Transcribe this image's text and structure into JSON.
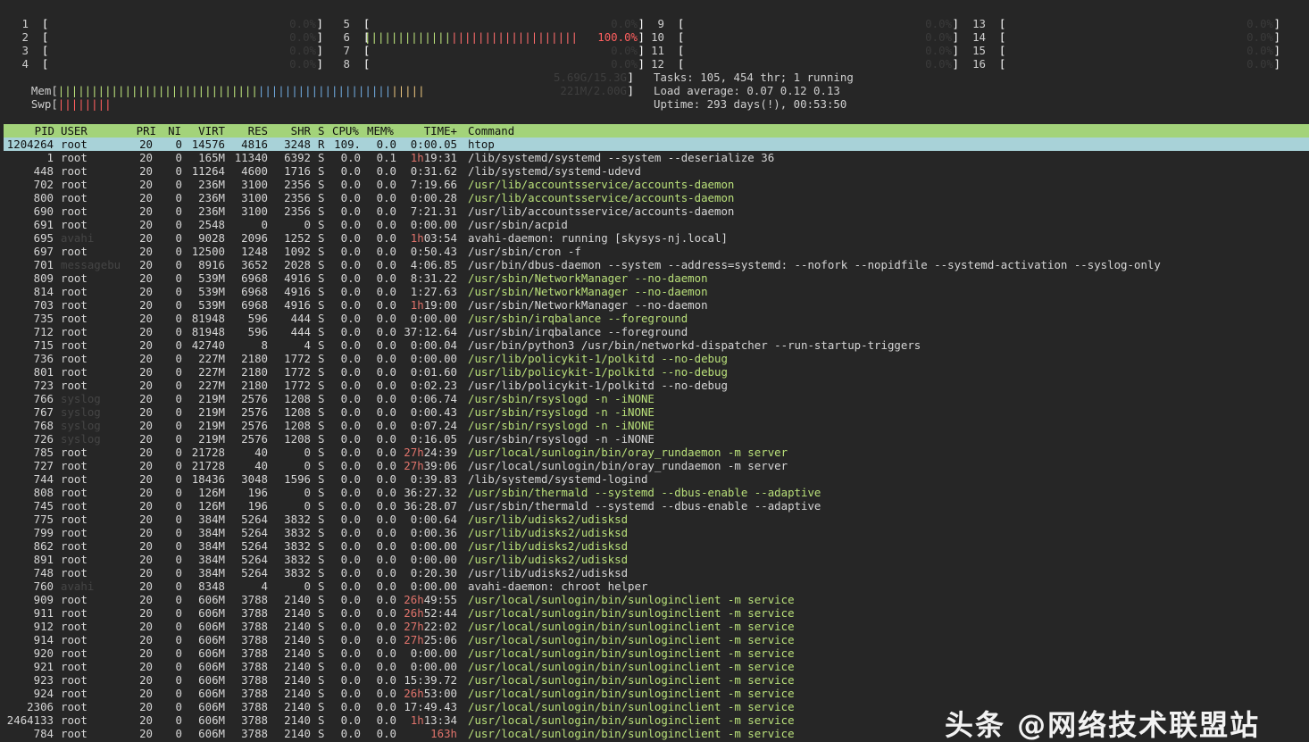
{
  "cpus": [
    {
      "n": "1",
      "pct": "0.0%",
      "fill": 0
    },
    {
      "n": "2",
      "pct": "0.0%",
      "fill": 0
    },
    {
      "n": "3",
      "pct": "0.0%",
      "fill": 0
    },
    {
      "n": "4",
      "pct": "0.0%",
      "fill": 0
    },
    {
      "n": "5",
      "pct": "0.0%",
      "fill": 0
    },
    {
      "n": "6",
      "pct": "100.0%",
      "fill": 1
    },
    {
      "n": "7",
      "pct": "0.0%",
      "fill": 0
    },
    {
      "n": "8",
      "pct": "0.0%",
      "fill": 0
    },
    {
      "n": "9",
      "pct": "0.0%",
      "fill": 0
    },
    {
      "n": "10",
      "pct": "0.0%",
      "fill": 0
    },
    {
      "n": "11",
      "pct": "0.0%",
      "fill": 0
    },
    {
      "n": "12",
      "pct": "0.0%",
      "fill": 0
    },
    {
      "n": "13",
      "pct": "0.0%",
      "fill": 0
    },
    {
      "n": "14",
      "pct": "0.0%",
      "fill": 0
    },
    {
      "n": "15",
      "pct": "0.0%",
      "fill": 0
    },
    {
      "n": "16",
      "pct": "0.0%",
      "fill": 0
    }
  ],
  "mem": {
    "label": "Mem",
    "value": "5.69G/15.3G",
    "fill": 0.372
  },
  "swp": {
    "label": "Swp",
    "value": "221M/2.00G",
    "fill": 0.108
  },
  "tasks": "Tasks: 105, 454 thr; 1 running",
  "load": "Load average: 0.07 0.12 0.13",
  "uptime": "Uptime: 293 days(!), 00:53:50",
  "columns": {
    "pid": "PID",
    "user": "USER",
    "pri": "PRI",
    "ni": "NI",
    "virt": "VIRT",
    "res": "RES",
    "shr": "SHR",
    "s": "S",
    "cpu": "CPU%",
    "mem": "MEM%",
    "time": "TIME+",
    "cmd": "Command"
  },
  "processes": [
    {
      "pid": "1204264",
      "user": "root",
      "pri": "20",
      "ni": "0",
      "virt": "14576",
      "res": "4816",
      "shr": "3248",
      "s": "R",
      "cpu": "109.",
      "mem": "0.0",
      "th": "",
      "time": "0:00.05",
      "cmd": "htop",
      "green": false,
      "dim": false
    },
    {
      "pid": "1",
      "user": "root",
      "pri": "20",
      "ni": "0",
      "virt": "165M",
      "res": "11340",
      "shr": "6392",
      "s": "S",
      "cpu": "0.0",
      "mem": "0.1",
      "th": "1h",
      "time": "19:31",
      "cmd": "/lib/systemd/systemd --system --deserialize 36",
      "green": false,
      "dim": false
    },
    {
      "pid": "448",
      "user": "root",
      "pri": "20",
      "ni": "0",
      "virt": "11264",
      "res": "4600",
      "shr": "1716",
      "s": "S",
      "cpu": "0.0",
      "mem": "0.0",
      "th": "",
      "time": "0:31.62",
      "cmd": "/lib/systemd/systemd-udevd",
      "green": false,
      "dim": false
    },
    {
      "pid": "702",
      "user": "root",
      "pri": "20",
      "ni": "0",
      "virt": "236M",
      "res": "3100",
      "shr": "2356",
      "s": "S",
      "cpu": "0.0",
      "mem": "0.0",
      "th": "",
      "time": "7:19.66",
      "cmd": "/usr/lib/accountsservice/accounts-daemon",
      "green": true,
      "dim": false
    },
    {
      "pid": "800",
      "user": "root",
      "pri": "20",
      "ni": "0",
      "virt": "236M",
      "res": "3100",
      "shr": "2356",
      "s": "S",
      "cpu": "0.0",
      "mem": "0.0",
      "th": "",
      "time": "0:00.28",
      "cmd": "/usr/lib/accountsservice/accounts-daemon",
      "green": true,
      "dim": false
    },
    {
      "pid": "690",
      "user": "root",
      "pri": "20",
      "ni": "0",
      "virt": "236M",
      "res": "3100",
      "shr": "2356",
      "s": "S",
      "cpu": "0.0",
      "mem": "0.0",
      "th": "",
      "time": "7:21.31",
      "cmd": "/usr/lib/accountsservice/accounts-daemon",
      "green": false,
      "dim": false
    },
    {
      "pid": "691",
      "user": "root",
      "pri": "20",
      "ni": "0",
      "virt": "2548",
      "res": "0",
      "shr": "0",
      "s": "S",
      "cpu": "0.0",
      "mem": "0.0",
      "th": "",
      "time": "0:00.00",
      "cmd": "/usr/sbin/acpid",
      "green": false,
      "dim": false
    },
    {
      "pid": "695",
      "user": "avahi",
      "pri": "20",
      "ni": "0",
      "virt": "9028",
      "res": "2096",
      "shr": "1252",
      "s": "S",
      "cpu": "0.0",
      "mem": "0.0",
      "th": "1h",
      "time": "03:54",
      "cmd": "avahi-daemon: running [skysys-nj.local]",
      "green": false,
      "dim": true
    },
    {
      "pid": "697",
      "user": "root",
      "pri": "20",
      "ni": "0",
      "virt": "12500",
      "res": "1248",
      "shr": "1092",
      "s": "S",
      "cpu": "0.0",
      "mem": "0.0",
      "th": "",
      "time": "0:50.43",
      "cmd": "/usr/sbin/cron -f",
      "green": false,
      "dim": false
    },
    {
      "pid": "701",
      "user": "messagebu",
      "pri": "20",
      "ni": "0",
      "virt": "8916",
      "res": "3652",
      "shr": "2028",
      "s": "S",
      "cpu": "0.0",
      "mem": "0.0",
      "th": "",
      "time": "4:06.85",
      "cmd": "/usr/bin/dbus-daemon --system --address=systemd: --nofork --nopidfile --systemd-activation --syslog-only",
      "green": false,
      "dim": true
    },
    {
      "pid": "809",
      "user": "root",
      "pri": "20",
      "ni": "0",
      "virt": "539M",
      "res": "6968",
      "shr": "4916",
      "s": "S",
      "cpu": "0.0",
      "mem": "0.0",
      "th": "",
      "time": "8:31.22",
      "cmd": "/usr/sbin/NetworkManager --no-daemon",
      "green": true,
      "dim": false
    },
    {
      "pid": "814",
      "user": "root",
      "pri": "20",
      "ni": "0",
      "virt": "539M",
      "res": "6968",
      "shr": "4916",
      "s": "S",
      "cpu": "0.0",
      "mem": "0.0",
      "th": "",
      "time": "1:27.63",
      "cmd": "/usr/sbin/NetworkManager --no-daemon",
      "green": true,
      "dim": false
    },
    {
      "pid": "703",
      "user": "root",
      "pri": "20",
      "ni": "0",
      "virt": "539M",
      "res": "6968",
      "shr": "4916",
      "s": "S",
      "cpu": "0.0",
      "mem": "0.0",
      "th": "1h",
      "time": "19:00",
      "cmd": "/usr/sbin/NetworkManager --no-daemon",
      "green": false,
      "dim": false
    },
    {
      "pid": "735",
      "user": "root",
      "pri": "20",
      "ni": "0",
      "virt": "81948",
      "res": "596",
      "shr": "444",
      "s": "S",
      "cpu": "0.0",
      "mem": "0.0",
      "th": "",
      "time": "0:00.00",
      "cmd": "/usr/sbin/irqbalance --foreground",
      "green": true,
      "dim": false
    },
    {
      "pid": "712",
      "user": "root",
      "pri": "20",
      "ni": "0",
      "virt": "81948",
      "res": "596",
      "shr": "444",
      "s": "S",
      "cpu": "0.0",
      "mem": "0.0",
      "th": "",
      "time": "37:12.64",
      "cmd": "/usr/sbin/irqbalance --foreground",
      "green": false,
      "dim": false
    },
    {
      "pid": "715",
      "user": "root",
      "pri": "20",
      "ni": "0",
      "virt": "42740",
      "res": "8",
      "shr": "4",
      "s": "S",
      "cpu": "0.0",
      "mem": "0.0",
      "th": "",
      "time": "0:00.04",
      "cmd": "/usr/bin/python3 /usr/bin/networkd-dispatcher --run-startup-triggers",
      "green": false,
      "dim": false
    },
    {
      "pid": "736",
      "user": "root",
      "pri": "20",
      "ni": "0",
      "virt": "227M",
      "res": "2180",
      "shr": "1772",
      "s": "S",
      "cpu": "0.0",
      "mem": "0.0",
      "th": "",
      "time": "0:00.00",
      "cmd": "/usr/lib/policykit-1/polkitd --no-debug",
      "green": true,
      "dim": false
    },
    {
      "pid": "801",
      "user": "root",
      "pri": "20",
      "ni": "0",
      "virt": "227M",
      "res": "2180",
      "shr": "1772",
      "s": "S",
      "cpu": "0.0",
      "mem": "0.0",
      "th": "",
      "time": "0:01.60",
      "cmd": "/usr/lib/policykit-1/polkitd --no-debug",
      "green": true,
      "dim": false
    },
    {
      "pid": "723",
      "user": "root",
      "pri": "20",
      "ni": "0",
      "virt": "227M",
      "res": "2180",
      "shr": "1772",
      "s": "S",
      "cpu": "0.0",
      "mem": "0.0",
      "th": "",
      "time": "0:02.23",
      "cmd": "/usr/lib/policykit-1/polkitd --no-debug",
      "green": false,
      "dim": false
    },
    {
      "pid": "766",
      "user": "syslog",
      "pri": "20",
      "ni": "0",
      "virt": "219M",
      "res": "2576",
      "shr": "1208",
      "s": "S",
      "cpu": "0.0",
      "mem": "0.0",
      "th": "",
      "time": "0:06.74",
      "cmd": "/usr/sbin/rsyslogd -n -iNONE",
      "green": true,
      "dim": true
    },
    {
      "pid": "767",
      "user": "syslog",
      "pri": "20",
      "ni": "0",
      "virt": "219M",
      "res": "2576",
      "shr": "1208",
      "s": "S",
      "cpu": "0.0",
      "mem": "0.0",
      "th": "",
      "time": "0:00.43",
      "cmd": "/usr/sbin/rsyslogd -n -iNONE",
      "green": true,
      "dim": true
    },
    {
      "pid": "768",
      "user": "syslog",
      "pri": "20",
      "ni": "0",
      "virt": "219M",
      "res": "2576",
      "shr": "1208",
      "s": "S",
      "cpu": "0.0",
      "mem": "0.0",
      "th": "",
      "time": "0:07.24",
      "cmd": "/usr/sbin/rsyslogd -n -iNONE",
      "green": true,
      "dim": true
    },
    {
      "pid": "726",
      "user": "syslog",
      "pri": "20",
      "ni": "0",
      "virt": "219M",
      "res": "2576",
      "shr": "1208",
      "s": "S",
      "cpu": "0.0",
      "mem": "0.0",
      "th": "",
      "time": "0:16.05",
      "cmd": "/usr/sbin/rsyslogd -n -iNONE",
      "green": false,
      "dim": true
    },
    {
      "pid": "785",
      "user": "root",
      "pri": "20",
      "ni": "0",
      "virt": "21728",
      "res": "40",
      "shr": "0",
      "s": "S",
      "cpu": "0.0",
      "mem": "0.0",
      "th": "27h",
      "time": "24:39",
      "cmd": "/usr/local/sunlogin/bin/oray_rundaemon -m server",
      "green": true,
      "dim": false
    },
    {
      "pid": "727",
      "user": "root",
      "pri": "20",
      "ni": "0",
      "virt": "21728",
      "res": "40",
      "shr": "0",
      "s": "S",
      "cpu": "0.0",
      "mem": "0.0",
      "th": "27h",
      "time": "39:06",
      "cmd": "/usr/local/sunlogin/bin/oray_rundaemon -m server",
      "green": false,
      "dim": false
    },
    {
      "pid": "744",
      "user": "root",
      "pri": "20",
      "ni": "0",
      "virt": "18436",
      "res": "3048",
      "shr": "1596",
      "s": "S",
      "cpu": "0.0",
      "mem": "0.0",
      "th": "",
      "time": "0:39.83",
      "cmd": "/lib/systemd/systemd-logind",
      "green": false,
      "dim": false
    },
    {
      "pid": "808",
      "user": "root",
      "pri": "20",
      "ni": "0",
      "virt": "126M",
      "res": "196",
      "shr": "0",
      "s": "S",
      "cpu": "0.0",
      "mem": "0.0",
      "th": "",
      "time": "36:27.32",
      "cmd": "/usr/sbin/thermald --systemd --dbus-enable --adaptive",
      "green": true,
      "dim": false
    },
    {
      "pid": "745",
      "user": "root",
      "pri": "20",
      "ni": "0",
      "virt": "126M",
      "res": "196",
      "shr": "0",
      "s": "S",
      "cpu": "0.0",
      "mem": "0.0",
      "th": "",
      "time": "36:28.07",
      "cmd": "/usr/sbin/thermald --systemd --dbus-enable --adaptive",
      "green": false,
      "dim": false
    },
    {
      "pid": "775",
      "user": "root",
      "pri": "20",
      "ni": "0",
      "virt": "384M",
      "res": "5264",
      "shr": "3832",
      "s": "S",
      "cpu": "0.0",
      "mem": "0.0",
      "th": "",
      "time": "0:00.64",
      "cmd": "/usr/lib/udisks2/udisksd",
      "green": true,
      "dim": false
    },
    {
      "pid": "799",
      "user": "root",
      "pri": "20",
      "ni": "0",
      "virt": "384M",
      "res": "5264",
      "shr": "3832",
      "s": "S",
      "cpu": "0.0",
      "mem": "0.0",
      "th": "",
      "time": "0:00.36",
      "cmd": "/usr/lib/udisks2/udisksd",
      "green": true,
      "dim": false
    },
    {
      "pid": "862",
      "user": "root",
      "pri": "20",
      "ni": "0",
      "virt": "384M",
      "res": "5264",
      "shr": "3832",
      "s": "S",
      "cpu": "0.0",
      "mem": "0.0",
      "th": "",
      "time": "0:00.00",
      "cmd": "/usr/lib/udisks2/udisksd",
      "green": true,
      "dim": false
    },
    {
      "pid": "891",
      "user": "root",
      "pri": "20",
      "ni": "0",
      "virt": "384M",
      "res": "5264",
      "shr": "3832",
      "s": "S",
      "cpu": "0.0",
      "mem": "0.0",
      "th": "",
      "time": "0:00.00",
      "cmd": "/usr/lib/udisks2/udisksd",
      "green": true,
      "dim": false
    },
    {
      "pid": "748",
      "user": "root",
      "pri": "20",
      "ni": "0",
      "virt": "384M",
      "res": "5264",
      "shr": "3832",
      "s": "S",
      "cpu": "0.0",
      "mem": "0.0",
      "th": "",
      "time": "0:20.30",
      "cmd": "/usr/lib/udisks2/udisksd",
      "green": false,
      "dim": false
    },
    {
      "pid": "760",
      "user": "avahi",
      "pri": "20",
      "ni": "0",
      "virt": "8348",
      "res": "4",
      "shr": "0",
      "s": "S",
      "cpu": "0.0",
      "mem": "0.0",
      "th": "",
      "time": "0:00.00",
      "cmd": "avahi-daemon: chroot helper",
      "green": false,
      "dim": true
    },
    {
      "pid": "909",
      "user": "root",
      "pri": "20",
      "ni": "0",
      "virt": "606M",
      "res": "3788",
      "shr": "2140",
      "s": "S",
      "cpu": "0.0",
      "mem": "0.0",
      "th": "26h",
      "time": "49:55",
      "cmd": "/usr/local/sunlogin/bin/sunloginclient -m service",
      "green": true,
      "dim": false
    },
    {
      "pid": "911",
      "user": "root",
      "pri": "20",
      "ni": "0",
      "virt": "606M",
      "res": "3788",
      "shr": "2140",
      "s": "S",
      "cpu": "0.0",
      "mem": "0.0",
      "th": "26h",
      "time": "52:44",
      "cmd": "/usr/local/sunlogin/bin/sunloginclient -m service",
      "green": true,
      "dim": false
    },
    {
      "pid": "912",
      "user": "root",
      "pri": "20",
      "ni": "0",
      "virt": "606M",
      "res": "3788",
      "shr": "2140",
      "s": "S",
      "cpu": "0.0",
      "mem": "0.0",
      "th": "27h",
      "time": "22:02",
      "cmd": "/usr/local/sunlogin/bin/sunloginclient -m service",
      "green": true,
      "dim": false
    },
    {
      "pid": "914",
      "user": "root",
      "pri": "20",
      "ni": "0",
      "virt": "606M",
      "res": "3788",
      "shr": "2140",
      "s": "S",
      "cpu": "0.0",
      "mem": "0.0",
      "th": "27h",
      "time": "25:06",
      "cmd": "/usr/local/sunlogin/bin/sunloginclient -m service",
      "green": true,
      "dim": false
    },
    {
      "pid": "920",
      "user": "root",
      "pri": "20",
      "ni": "0",
      "virt": "606M",
      "res": "3788",
      "shr": "2140",
      "s": "S",
      "cpu": "0.0",
      "mem": "0.0",
      "th": "",
      "time": "0:00.00",
      "cmd": "/usr/local/sunlogin/bin/sunloginclient -m service",
      "green": true,
      "dim": false
    },
    {
      "pid": "921",
      "user": "root",
      "pri": "20",
      "ni": "0",
      "virt": "606M",
      "res": "3788",
      "shr": "2140",
      "s": "S",
      "cpu": "0.0",
      "mem": "0.0",
      "th": "",
      "time": "0:00.00",
      "cmd": "/usr/local/sunlogin/bin/sunloginclient -m service",
      "green": true,
      "dim": false
    },
    {
      "pid": "923",
      "user": "root",
      "pri": "20",
      "ni": "0",
      "virt": "606M",
      "res": "3788",
      "shr": "2140",
      "s": "S",
      "cpu": "0.0",
      "mem": "0.0",
      "th": "",
      "time": "15:39.72",
      "cmd": "/usr/local/sunlogin/bin/sunloginclient -m service",
      "green": true,
      "dim": false
    },
    {
      "pid": "924",
      "user": "root",
      "pri": "20",
      "ni": "0",
      "virt": "606M",
      "res": "3788",
      "shr": "2140",
      "s": "S",
      "cpu": "0.0",
      "mem": "0.0",
      "th": "26h",
      "time": "53:00",
      "cmd": "/usr/local/sunlogin/bin/sunloginclient -m service",
      "green": true,
      "dim": false
    },
    {
      "pid": "2306",
      "user": "root",
      "pri": "20",
      "ni": "0",
      "virt": "606M",
      "res": "3788",
      "shr": "2140",
      "s": "S",
      "cpu": "0.0",
      "mem": "0.0",
      "th": "",
      "time": "17:49.43",
      "cmd": "/usr/local/sunlogin/bin/sunloginclient -m service",
      "green": true,
      "dim": false
    },
    {
      "pid": "2464133",
      "user": "root",
      "pri": "20",
      "ni": "0",
      "virt": "606M",
      "res": "3788",
      "shr": "2140",
      "s": "S",
      "cpu": "0.0",
      "mem": "0.0",
      "th": "1h",
      "time": "13:34",
      "cmd": "/usr/local/sunlogin/bin/sunloginclient -m service",
      "green": true,
      "dim": false
    },
    {
      "pid": "784",
      "user": "root",
      "pri": "20",
      "ni": "0",
      "virt": "606M",
      "res": "3788",
      "shr": "2140",
      "s": "S",
      "cpu": "0.0",
      "mem": "0.0",
      "th": "163h",
      "time": "",
      "cmd": "/usr/local/sunlogin/bin/sunloginclient -m service",
      "green": true,
      "dim": false
    }
  ],
  "watermark": "头条 @网络技术联盟站",
  "colors": {
    "background": "#262626",
    "header_bar": "#a3d37a",
    "selected_row": "#a8d2d8",
    "command_green": "#b9e07a",
    "hours": "#e0736b"
  }
}
